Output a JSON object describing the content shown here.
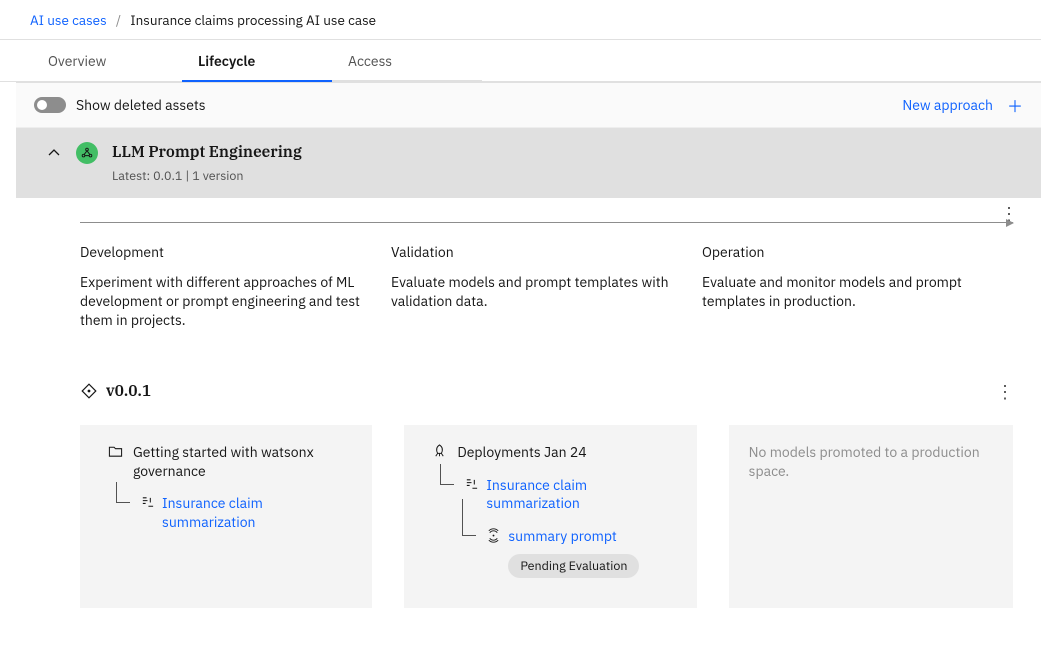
{
  "breadcrumb": {
    "parent": "AI use cases",
    "current": "Insurance claims processing AI use case"
  },
  "tabs": [
    "Overview",
    "Lifecycle",
    "Access"
  ],
  "toolbar": {
    "toggle_label": "Show deleted assets",
    "new_approach": "New approach"
  },
  "approach": {
    "title": "LLM Prompt Engineering",
    "subtitle": "Latest: 0.0.1 | 1 version"
  },
  "phases": [
    {
      "title": "Development",
      "desc": "Experiment with different approaches of ML development or prompt engineering and test them in projects."
    },
    {
      "title": "Validation",
      "desc": "Evaluate models and prompt templates with validation data."
    },
    {
      "title": "Operation",
      "desc": "Evaluate and monitor models and prompt templates in production."
    }
  ],
  "version": {
    "label": "v0.0.1"
  },
  "cards": {
    "dev": {
      "title": "Getting started with watsonx governance",
      "asset": "Insurance claim summarization"
    },
    "val": {
      "title": "Deployments Jan 24",
      "asset": "Insurance claim summarization",
      "child": "summary prompt",
      "badge": "Pending Evaluation"
    },
    "op_empty": "No models promoted to a production space."
  }
}
